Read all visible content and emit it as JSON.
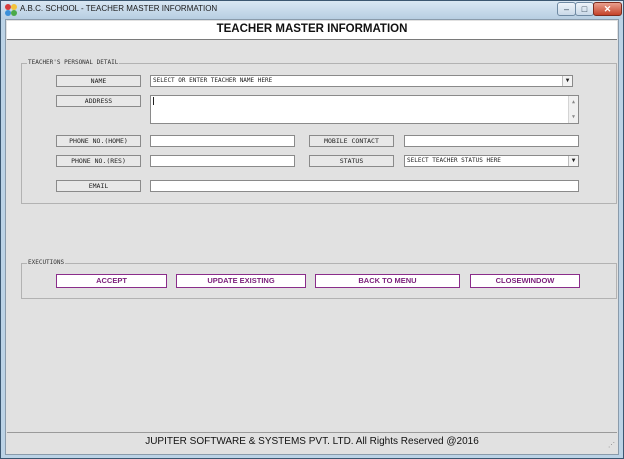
{
  "window": {
    "title": "A.B.C. SCHOOL - TEACHER MASTER INFORMATION",
    "controls": {
      "minimize": "–",
      "maximize": "□",
      "close": "✕"
    }
  },
  "header": {
    "title": "TEACHER MASTER INFORMATION"
  },
  "personal": {
    "legend": "TEACHER'S PERSONAL DETAIL",
    "name_label": "NAME",
    "name_value": "SELECT OR ENTER TEACHER NAME HERE",
    "address_label": "ADDRESS",
    "address_value": "",
    "phone_home_label": "PHONE NO.(HOME)",
    "phone_home_value": "",
    "mobile_label": "MOBILE CONTACT",
    "mobile_value": "",
    "phone_res_label": "PHONE NO.(RES)",
    "phone_res_value": "",
    "status_label": "STATUS",
    "status_value": "SELECT TEACHER STATUS HERE",
    "email_label": "EMAIL",
    "email_value": ""
  },
  "executions": {
    "legend": "EXECUTIONS",
    "accept": "ACCEPT",
    "update": "UPDATE EXISTING",
    "back": "BACK TO MENU",
    "close": "CLOSEWINDOW"
  },
  "footer": {
    "text": "JUPITER SOFTWARE & SYSTEMS PVT. LTD. All Rights Reserved @2016"
  },
  "colors": {
    "accent_purple": "#7a1f7a",
    "title_bar": "#bcd3e6",
    "client_bg": "#e1e1e1",
    "close_button": "#c5422a"
  },
  "icons": {
    "app": "app-icon",
    "dropdown": "chevron-down-icon",
    "scroll_up": "scroll-up-icon",
    "scroll_down": "scroll-down-icon"
  }
}
